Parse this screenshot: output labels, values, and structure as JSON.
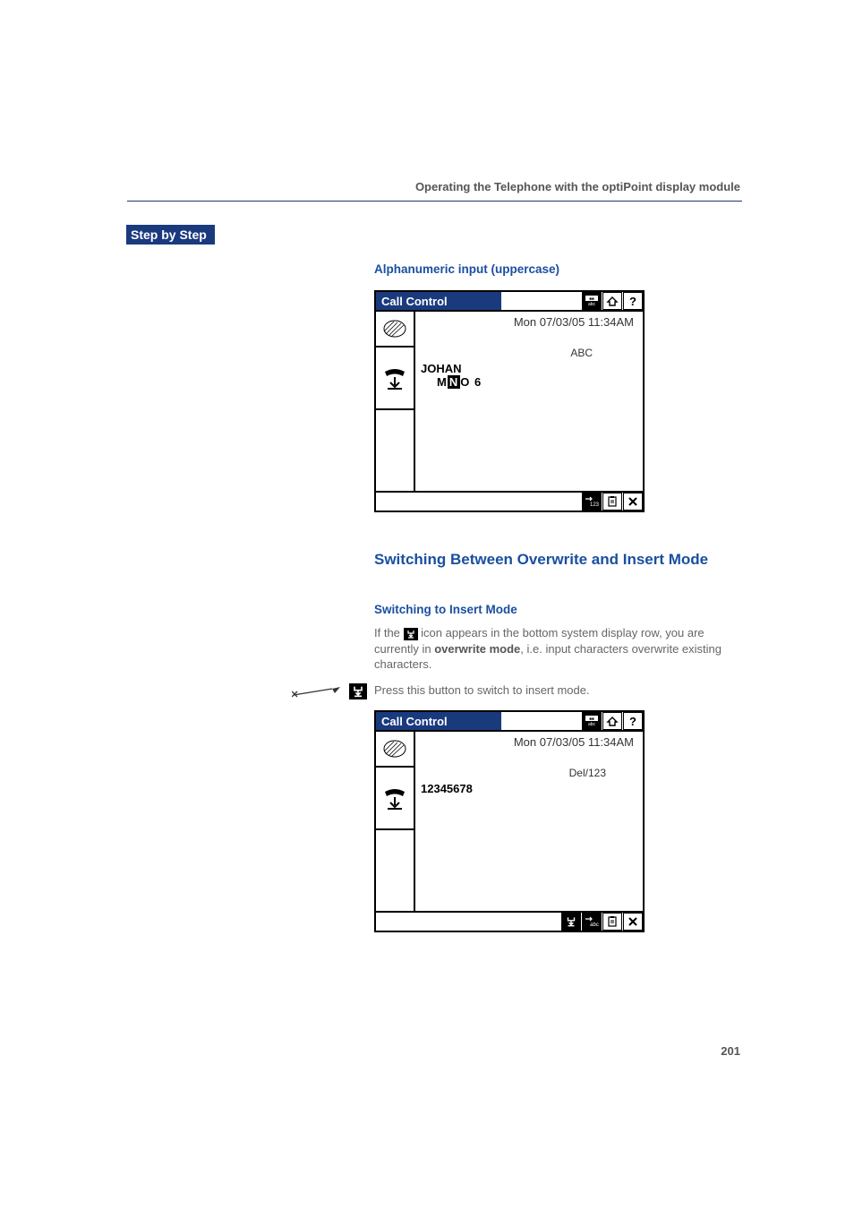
{
  "header": {
    "running_title": "Operating the Telephone with the optiPoint display module"
  },
  "sidebar": {
    "title": "Step by Step"
  },
  "sections": {
    "uppercase_heading": "Alphanumeric input (uppercase)",
    "switch_heading": "Switching Between Overwrite and Insert Mode",
    "insert_subheading": "Switching to Insert Mode",
    "body1_a": "If the ",
    "body1_b": " icon appears in the bottom system display row, you are currently in ",
    "body1_bold": "overwrite mode",
    "body1_c": ", i.e. input characters overwrite existing characters.",
    "body2": "Press this button to switch to insert mode."
  },
  "screen1": {
    "title": "Call Control",
    "datetime": "Mon 07/03/05 11:34AM",
    "mode_label": "ABC",
    "input_name": "JOHAN",
    "input_chars_pre": "M",
    "input_chars_cursor": "N",
    "input_chars_post": "O 6",
    "top_icons": {
      "abc": "abc",
      "home": "home",
      "help": "?"
    },
    "bottom_icons": {
      "to123": "123",
      "clipboard": "clip",
      "close": "×"
    }
  },
  "screen2": {
    "title": "Call Control",
    "datetime": "Mon 07/03/05 11:34AM",
    "mode_label": "Del/123",
    "input_value": "12345678",
    "top_icons": {
      "abc": "abc",
      "home": "home",
      "help": "?"
    },
    "bottom_icons": {
      "overwrite": "ovr",
      "toabc": "abc",
      "clipboard": "clip",
      "close": "×"
    }
  },
  "page_number": "201"
}
